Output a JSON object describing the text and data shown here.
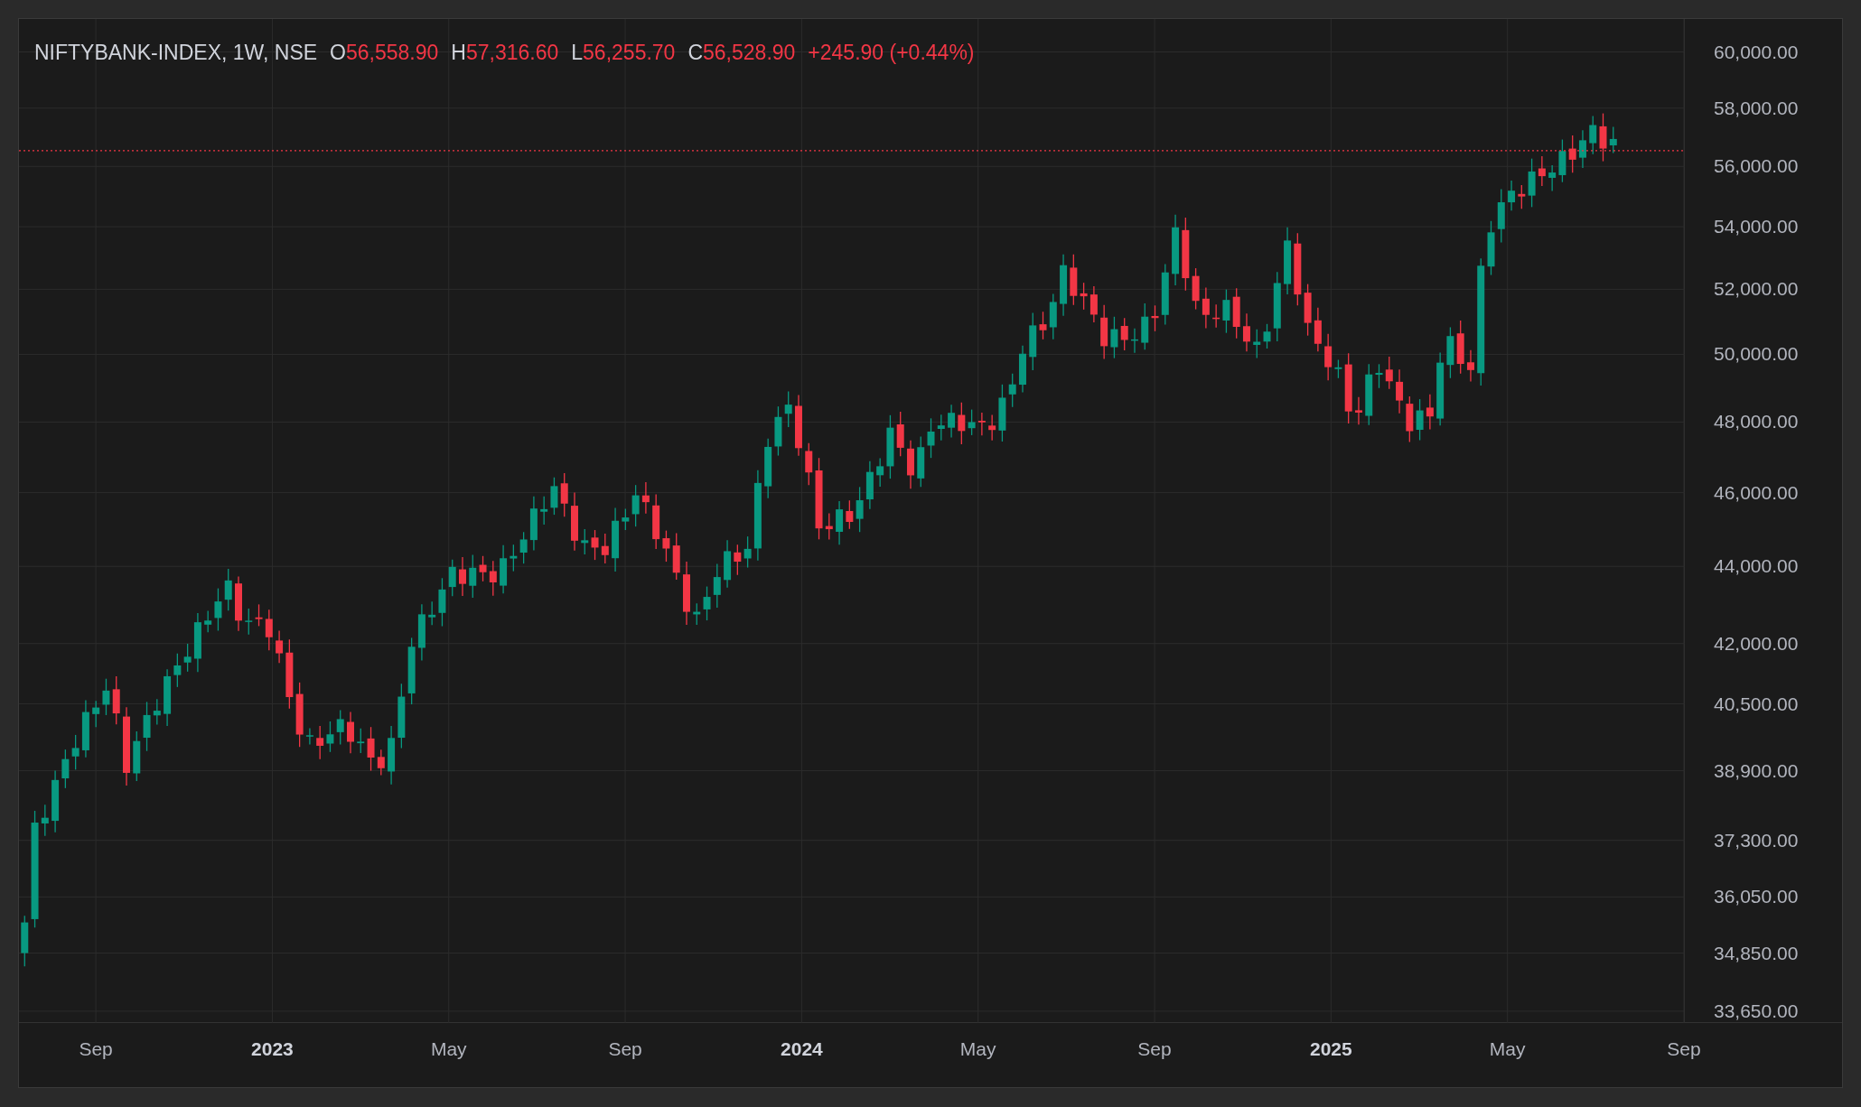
{
  "legend": {
    "symbol": "NIFTYBANK-INDEX, 1W, NSE",
    "fields": [
      {
        "label": "O",
        "value": "56,558.90"
      },
      {
        "label": "H",
        "value": "57,316.60"
      },
      {
        "label": "L",
        "value": "56,255.70"
      },
      {
        "label": "C",
        "value": "56,528.90"
      }
    ],
    "change": "+245.90 (+0.44%)"
  },
  "price_axis": [
    "60,000.00",
    "58,000.00",
    "56,000.00",
    "54,000.00",
    "52,000.00",
    "50,000.00",
    "48,000.00",
    "46,000.00",
    "44,000.00",
    "42,000.00",
    "40,500.00",
    "38,900.00",
    "37,300.00",
    "36,050.00",
    "34,850.00",
    "33,650.00"
  ],
  "time_axis": [
    {
      "label": "Sep",
      "bold": false
    },
    {
      "label": "2023",
      "bold": true
    },
    {
      "label": "May",
      "bold": false
    },
    {
      "label": "Sep",
      "bold": false
    },
    {
      "label": "2024",
      "bold": true
    },
    {
      "label": "May",
      "bold": false
    },
    {
      "label": "Sep",
      "bold": false
    },
    {
      "label": "2025",
      "bold": true
    },
    {
      "label": "May",
      "bold": false
    },
    {
      "label": "Sep",
      "bold": false
    }
  ]
}
